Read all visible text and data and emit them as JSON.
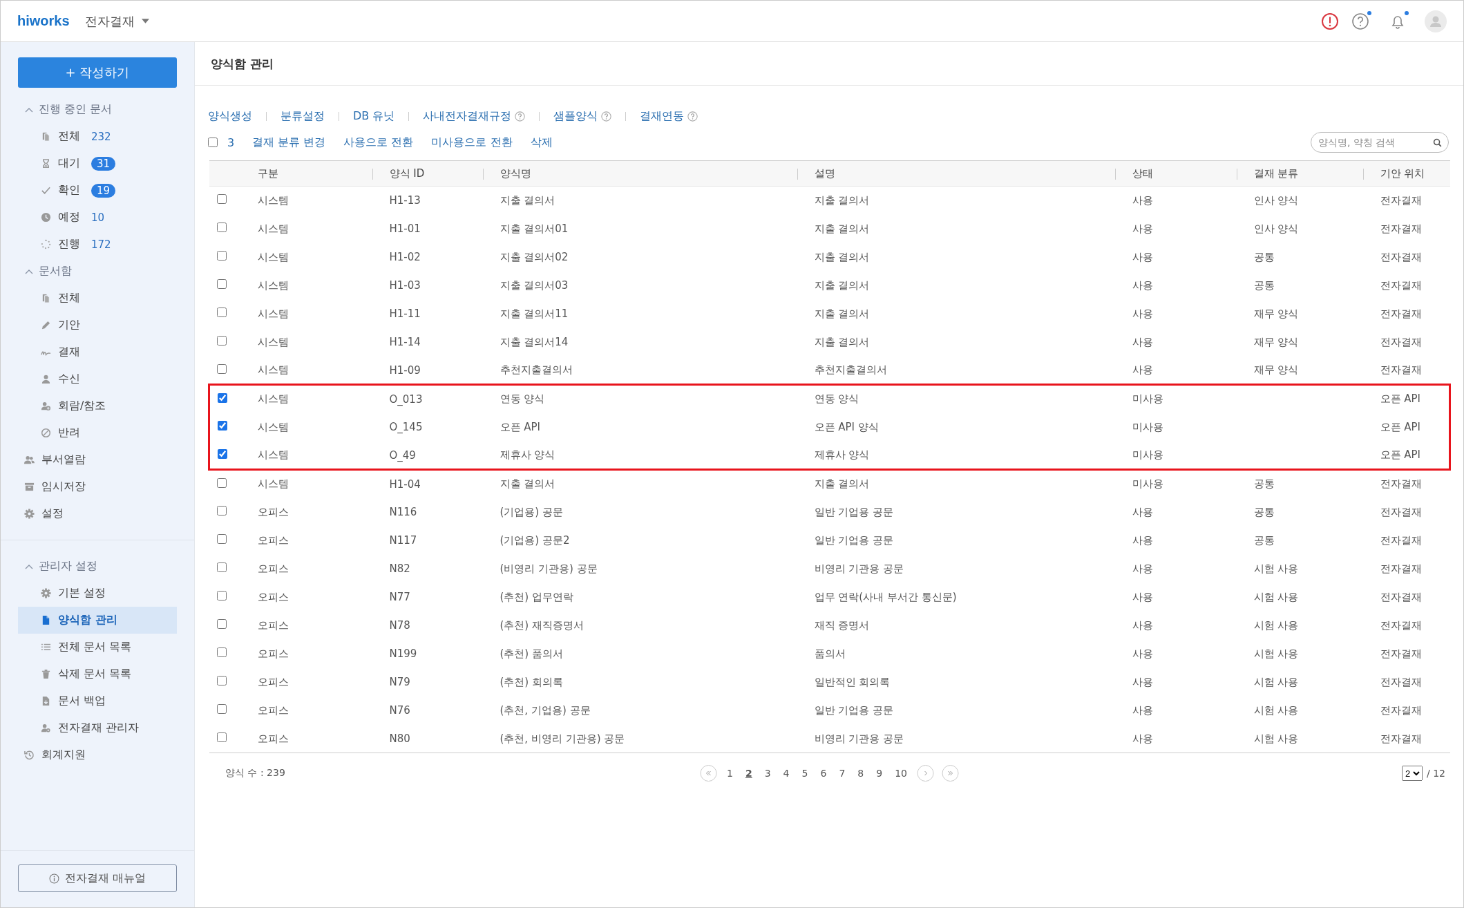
{
  "header": {
    "logo": "hiworks",
    "app_name": "전자결재",
    "help_dot": true,
    "bell_dot": true
  },
  "sidebar": {
    "compose_button": "+ 작성하기",
    "groups": [
      {
        "label": "진행 중인 문서",
        "expanded": true,
        "items": [
          {
            "label": "전체",
            "count": "232",
            "badge": false
          },
          {
            "label": "대기",
            "count": "31",
            "badge": true
          },
          {
            "label": "확인",
            "count": "19",
            "badge": true
          },
          {
            "label": "예정",
            "count": "10",
            "badge": false
          },
          {
            "label": "진행",
            "count": "172",
            "badge": false
          }
        ]
      },
      {
        "label": "문서함",
        "expanded": true,
        "items": [
          {
            "label": "전체"
          },
          {
            "label": "기안"
          },
          {
            "label": "결재"
          },
          {
            "label": "수신"
          },
          {
            "label": "회람/참조"
          },
          {
            "label": "반려"
          }
        ]
      }
    ],
    "links": [
      {
        "label": "부서열람"
      },
      {
        "label": "임시저장"
      },
      {
        "label": "설정"
      }
    ],
    "admin": {
      "label": "관리자 설정",
      "expanded": true,
      "items": [
        {
          "label": "기본 설정",
          "selected": false
        },
        {
          "label": "양식함 관리",
          "selected": true
        },
        {
          "label": "전체 문서 목록",
          "selected": false
        },
        {
          "label": "삭제 문서 목록",
          "selected": false
        },
        {
          "label": "문서 백업",
          "selected": false
        },
        {
          "label": "전자결재 관리자",
          "selected": false
        }
      ]
    },
    "bottom_link": "회계지원",
    "manual_button": "전자결재 매뉴얼"
  },
  "page_title": "양식함 관리",
  "menu_links": [
    {
      "label": "양식생성",
      "help": false
    },
    {
      "label": "분류설정",
      "help": false
    },
    {
      "label": "DB 유닛",
      "help": false
    },
    {
      "label": "사내전자결재규정",
      "help": true
    },
    {
      "label": "샘플양식",
      "help": true
    },
    {
      "label": "결재연동",
      "help": true
    }
  ],
  "actions": {
    "select_all": false,
    "selected_count": "3",
    "buttons": [
      "결재 분류 변경",
      "사용으로 전환",
      "미사용으로 전환",
      "삭제"
    ]
  },
  "search": {
    "placeholder": "양식명, 약칭 검색"
  },
  "table": {
    "columns": [
      "구분",
      "양식 ID",
      "양식명",
      "설명",
      "상태",
      "결재 분류",
      "기안 위치"
    ],
    "rows": [
      {
        "checked": false,
        "highlighted": false,
        "cells": [
          "시스템",
          "H1-13",
          "지출 결의서",
          "지출 결의서",
          "사용",
          "인사 양식",
          "전자결재"
        ]
      },
      {
        "checked": false,
        "highlighted": false,
        "cells": [
          "시스템",
          "H1-01",
          "지출 결의서01",
          "지출 결의서",
          "사용",
          "인사 양식",
          "전자결재"
        ]
      },
      {
        "checked": false,
        "highlighted": false,
        "cells": [
          "시스템",
          "H1-02",
          "지출 결의서02",
          "지출 결의서",
          "사용",
          "공통",
          "전자결재"
        ]
      },
      {
        "checked": false,
        "highlighted": false,
        "cells": [
          "시스템",
          "H1-03",
          "지출 결의서03",
          "지출 결의서",
          "사용",
          "공통",
          "전자결재"
        ]
      },
      {
        "checked": false,
        "highlighted": false,
        "cells": [
          "시스템",
          "H1-11",
          "지출 결의서11",
          "지출 결의서",
          "사용",
          "재무 양식",
          "전자결재"
        ]
      },
      {
        "checked": false,
        "highlighted": false,
        "cells": [
          "시스템",
          "H1-14",
          "지출 결의서14",
          "지출 결의서",
          "사용",
          "재무 양식",
          "전자결재"
        ]
      },
      {
        "checked": false,
        "highlighted": false,
        "cells": [
          "시스템",
          "H1-09",
          "추천지출결의서",
          "추천지출결의서",
          "사용",
          "재무 양식",
          "전자결재"
        ]
      },
      {
        "checked": true,
        "highlighted": true,
        "cells": [
          "시스템",
          "O_013",
          "연동 양식",
          "연동 양식",
          "미사용",
          "",
          "오픈 API"
        ]
      },
      {
        "checked": true,
        "highlighted": true,
        "cells": [
          "시스템",
          "O_145",
          "오픈 API",
          "오픈 API 양식",
          "미사용",
          "",
          "오픈 API"
        ]
      },
      {
        "checked": true,
        "highlighted": true,
        "cells": [
          "시스템",
          "O_49",
          "제휴사 양식",
          "제휴사 양식",
          "미사용",
          "",
          "오픈 API"
        ]
      },
      {
        "checked": false,
        "highlighted": false,
        "cells": [
          "시스템",
          "H1-04",
          "지출 결의서",
          "지출 결의서",
          "미사용",
          "공통",
          "전자결재"
        ]
      },
      {
        "checked": false,
        "highlighted": false,
        "cells": [
          "오피스",
          "N116",
          "(기업용) 공문",
          "일반 기업용 공문",
          "사용",
          "공통",
          "전자결재"
        ]
      },
      {
        "checked": false,
        "highlighted": false,
        "cells": [
          "오피스",
          "N117",
          "(기업용) 공문2",
          "일반 기업용 공문",
          "사용",
          "공통",
          "전자결재"
        ]
      },
      {
        "checked": false,
        "highlighted": false,
        "cells": [
          "오피스",
          "N82",
          "(비영리 기관용) 공문",
          "비영리 기관용 공문",
          "사용",
          "시험 사용",
          "전자결재"
        ]
      },
      {
        "checked": false,
        "highlighted": false,
        "cells": [
          "오피스",
          "N77",
          "(추천) 업무연락",
          "업무 연락(사내 부서간 통신문)",
          "사용",
          "시험 사용",
          "전자결재"
        ]
      },
      {
        "checked": false,
        "highlighted": false,
        "cells": [
          "오피스",
          "N78",
          "(추천) 재직증명서",
          "재직 증명서",
          "사용",
          "시험 사용",
          "전자결재"
        ]
      },
      {
        "checked": false,
        "highlighted": false,
        "cells": [
          "오피스",
          "N199",
          "(추천) 품의서",
          "품의서",
          "사용",
          "시험 사용",
          "전자결재"
        ]
      },
      {
        "checked": false,
        "highlighted": false,
        "cells": [
          "오피스",
          "N79",
          "(추천) 회의록",
          "일반적인 회의록",
          "사용",
          "시험 사용",
          "전자결재"
        ]
      },
      {
        "checked": false,
        "highlighted": false,
        "cells": [
          "오피스",
          "N76",
          "(추천, 기업용) 공문",
          "일반 기업용 공문",
          "사용",
          "시험 사용",
          "전자결재"
        ]
      },
      {
        "checked": false,
        "highlighted": false,
        "cells": [
          "오피스",
          "N80",
          "(추천, 비영리 기관용) 공문",
          "비영리 기관용 공문",
          "사용",
          "시험 사용",
          "전자결재"
        ]
      }
    ]
  },
  "footer": {
    "total": "양식 수 : 239",
    "pages": [
      {
        "label": "1",
        "selected": false
      },
      {
        "label": "2",
        "selected": true
      },
      {
        "label": "3",
        "selected": false
      },
      {
        "label": "4",
        "selected": false
      },
      {
        "label": "5",
        "selected": false
      },
      {
        "label": "6",
        "selected": false
      },
      {
        "label": "7",
        "selected": false
      },
      {
        "label": "8",
        "selected": false
      },
      {
        "label": "9",
        "selected": false
      },
      {
        "label": "10",
        "selected": false
      }
    ],
    "page_select": "2",
    "page_total": "/ 12"
  }
}
